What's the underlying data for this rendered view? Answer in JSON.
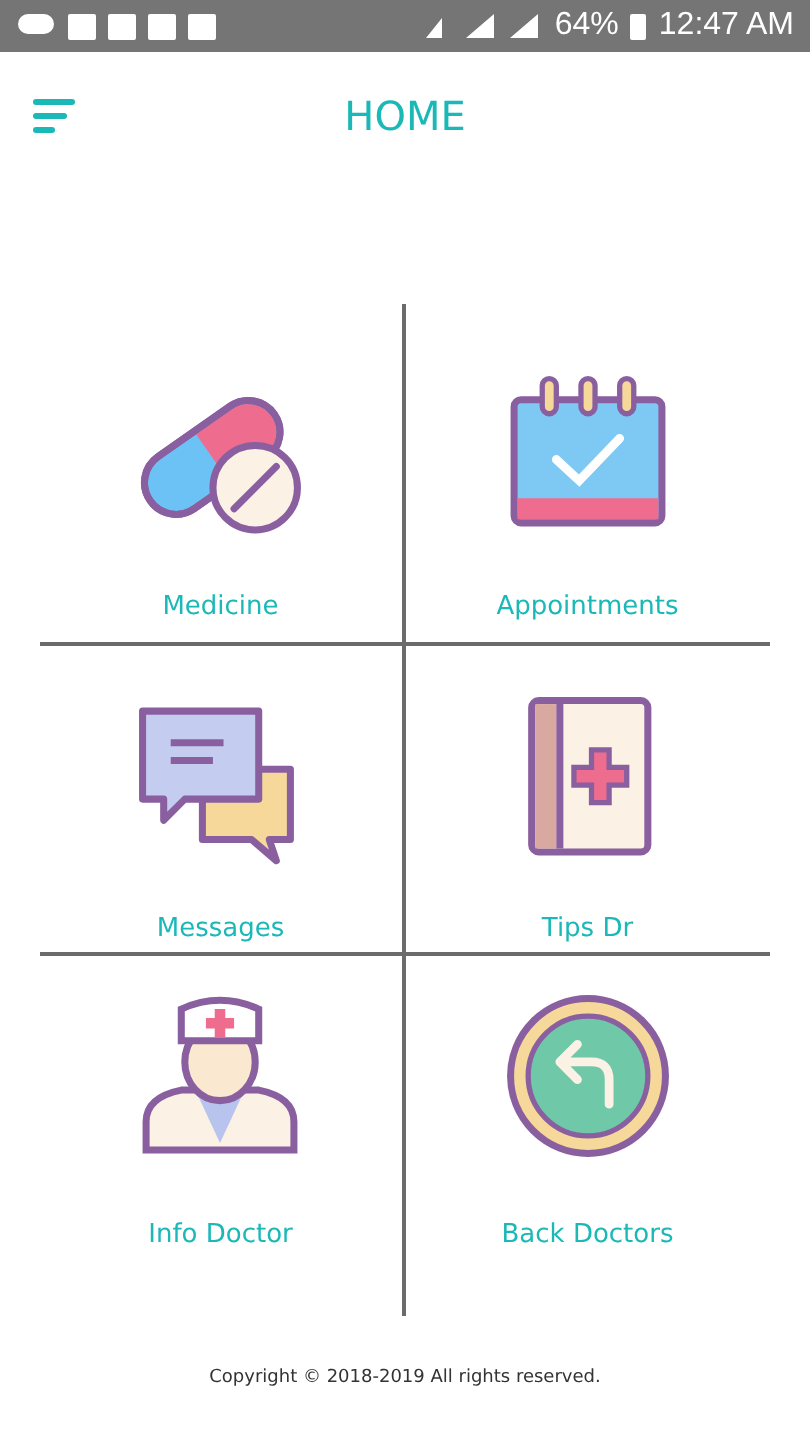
{
  "status_bar": {
    "battery": "64%",
    "time": "12:47 AM"
  },
  "header": {
    "title": "HOME"
  },
  "tiles": [
    {
      "label": "Medicine",
      "kind": "pill"
    },
    {
      "label": "Appointments",
      "kind": "calendar"
    },
    {
      "label": "Messages",
      "kind": "chat"
    },
    {
      "label": "Tips Dr",
      "kind": "book"
    },
    {
      "label": "Info Doctor",
      "kind": "doctor"
    },
    {
      "label": "Back Doctors",
      "kind": "back"
    }
  ],
  "footer": {
    "copyright": "Copyright © 2018-2019 All rights reserved."
  }
}
